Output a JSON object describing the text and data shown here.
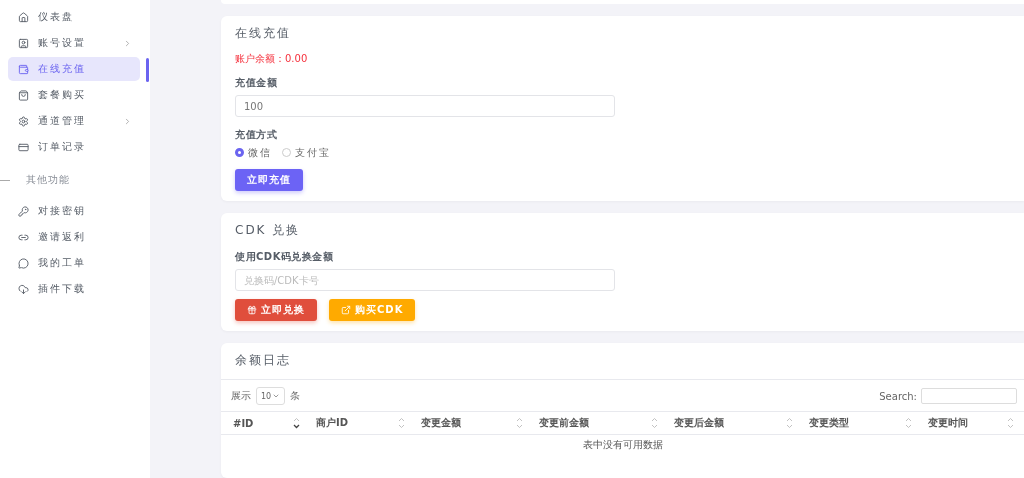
{
  "sidebar": {
    "items": [
      {
        "label": "仪表盘",
        "selected": false,
        "has_submenu": false
      },
      {
        "label": "账号设置",
        "selected": false,
        "has_submenu": true
      },
      {
        "label": "在线充值",
        "selected": true,
        "has_submenu": false
      },
      {
        "label": "套餐购买",
        "selected": false,
        "has_submenu": false
      },
      {
        "label": "通道管理",
        "selected": false,
        "has_submenu": true
      },
      {
        "label": "订单记录",
        "selected": false,
        "has_submenu": false
      }
    ],
    "section_label": "其他功能",
    "extra_items": [
      {
        "label": "对接密钥",
        "selected": false,
        "has_submenu": false
      },
      {
        "label": "邀请返利",
        "selected": false,
        "has_submenu": false
      },
      {
        "label": "我的工单",
        "selected": false,
        "has_submenu": false
      },
      {
        "label": "插件下载",
        "selected": false,
        "has_submenu": false
      }
    ]
  },
  "recharge": {
    "title": "在线充值",
    "balance": "账户余额：0.00",
    "amount_label": "充值金额",
    "amount_value": "100",
    "method_label": "充值方式",
    "methods": [
      {
        "label": "微信",
        "selected": true
      },
      {
        "label": "支付宝",
        "selected": false
      }
    ],
    "submit": "立即充值"
  },
  "cdk": {
    "title": "CDK 兑换",
    "field_label": "使用CDK码兑换金额",
    "placeholder": "兑换码/CDK卡号",
    "redeem": "立即兑换",
    "buy": "购买CDK"
  },
  "log": {
    "title": "余额日志",
    "show_label": "展示",
    "page_size": "10",
    "unit": "条",
    "search_label": "Search:",
    "columns": [
      {
        "label": "#ID",
        "sorted": true
      },
      {
        "label": "商户ID",
        "sorted": false
      },
      {
        "label": "变更金额",
        "sorted": false
      },
      {
        "label": "变更前金额",
        "sorted": false
      },
      {
        "label": "变更后金额",
        "sorted": false
      },
      {
        "label": "变更类型",
        "sorted": false
      },
      {
        "label": "变更时间",
        "sorted": false
      }
    ],
    "empty": "表中没有可用数据"
  }
}
